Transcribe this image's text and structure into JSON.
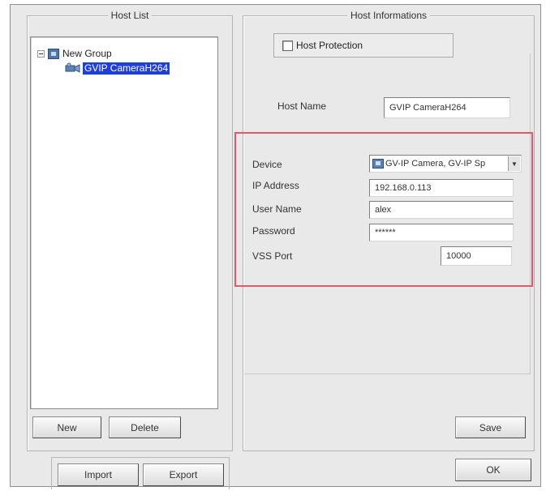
{
  "host_list": {
    "title": "Host List",
    "tree": {
      "group_label": "New Group",
      "host_label": "GVIP CameraH264"
    },
    "new_label": "New",
    "delete_label": "Delete"
  },
  "host_info": {
    "title": "Host Informations",
    "host_protection_label": "Host Protection",
    "host_name_label": "Host Name",
    "host_name_value": "GVIP CameraH264",
    "fields": {
      "device_label": "Device",
      "device_value": "GV-IP Camera, GV-IP Sp",
      "ip_label": "IP Address",
      "ip_value": "192.168.0.113",
      "user_label": "User Name",
      "user_value": "alex",
      "password_label": "Password",
      "password_value": "******",
      "vss_port_label": "VSS Port",
      "vss_port_value": "10000"
    },
    "save_label": "Save"
  },
  "footer": {
    "import_label": "Import",
    "export_label": "Export",
    "ok_label": "OK"
  },
  "colors": {
    "selection": "#1f3fd6",
    "highlight_box": "#e05a6a"
  }
}
